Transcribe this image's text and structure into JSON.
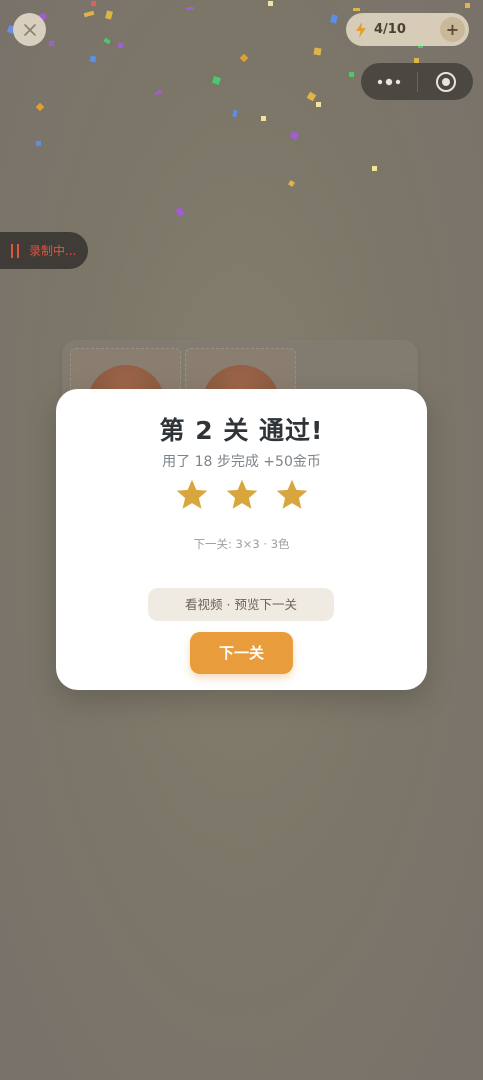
{
  "top_bar": {
    "energy_count": "4/10",
    "energy_plus": "+"
  },
  "recording": {
    "label": "录制中..."
  },
  "modal": {
    "title": "第 2 关 通过!",
    "subtitle": "用了 18 步完成  +50金币",
    "stars_earned": 3,
    "stars_total": 3,
    "next_level_info": "下一关: 3×3 · 3色",
    "video_button_label": "看视频 · 预览下一关",
    "next_button_label": "下一关"
  },
  "colors": {
    "accent": "#e89c3c",
    "star": "#d9a63e",
    "recording": "#e0543c"
  },
  "icons": [
    "close-icon",
    "bolt-icon",
    "plus-icon",
    "more-dots-icon",
    "target-icon",
    "pause-bars-icon",
    "star-icon"
  ]
}
